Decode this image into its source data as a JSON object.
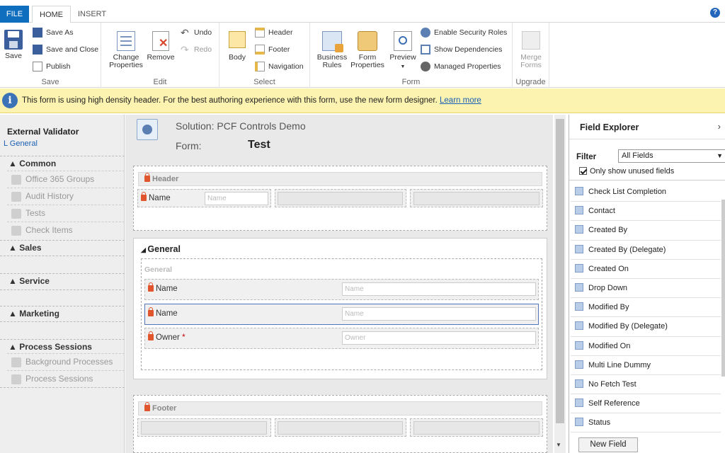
{
  "tabs": {
    "file": "FILE",
    "home": "HOME",
    "insert": "INSERT"
  },
  "help_label": "?",
  "ribbon": {
    "save": {
      "save": "Save",
      "save_as": "Save As",
      "save_close": "Save and Close",
      "publish": "Publish",
      "label": "Save"
    },
    "edit": {
      "change_properties_1": "Change",
      "change_properties_2": "Properties",
      "remove": "Remove",
      "undo": "Undo",
      "redo": "Redo",
      "label": "Edit"
    },
    "select": {
      "body": "Body",
      "header": "Header",
      "footer": "Footer",
      "navigation": "Navigation",
      "label": "Select"
    },
    "form": {
      "business_rules_1": "Business",
      "business_rules_2": "Rules",
      "form_properties_1": "Form",
      "form_properties_2": "Properties",
      "preview": "Preview",
      "enable_security": "Enable Security Roles",
      "show_dependencies": "Show Dependencies",
      "managed_properties": "Managed Properties",
      "label": "Form"
    },
    "upgrade": {
      "merge_1": "Merge",
      "merge_2": "Forms",
      "label": "Upgrade"
    }
  },
  "notice": {
    "message": "This form is using high density header. For the best authoring experience with this form, use the new form designer.",
    "link": "Learn more"
  },
  "leftnav": {
    "title": "External Validator",
    "sub": "L General",
    "sections": [
      {
        "label": "Common",
        "items": [
          "Office 365 Groups",
          "Audit History",
          "Tests",
          "Check Items"
        ]
      },
      {
        "label": "Sales",
        "items": []
      },
      {
        "label": "Service",
        "items": []
      },
      {
        "label": "Marketing",
        "items": []
      },
      {
        "label": "Process Sessions",
        "items": [
          "Background Processes",
          "Process Sessions"
        ]
      }
    ]
  },
  "canvas": {
    "solution": "Solution: PCF Controls Demo",
    "form_label": "Form:",
    "form_name": "Test",
    "header_label": "Header",
    "header_field": "Name",
    "header_placeholder": "Name",
    "general_tab": "General",
    "general_section": "General",
    "fields": [
      {
        "label": "Name",
        "placeholder": "Name",
        "required": false
      },
      {
        "label": "Name",
        "placeholder": "Name",
        "required": false
      },
      {
        "label": "Owner",
        "placeholder": "Owner",
        "required": true
      }
    ],
    "footer_label": "Footer",
    "required_mark": "*"
  },
  "field_explorer": {
    "title": "Field Explorer",
    "chevron": "›",
    "filter_label": "Filter",
    "filter_value": "All Fields",
    "dd_arrow": "▼",
    "only_unused": "Only show unused fields",
    "items": [
      "Check List Completion",
      "Contact",
      "Created By",
      "Created By (Delegate)",
      "Created On",
      "Drop Down",
      "Modified By",
      "Modified By (Delegate)",
      "Modified On",
      "Multi Line Dummy",
      "No Fetch Test",
      "Self Reference",
      "Status"
    ],
    "new_field": "New Field"
  },
  "scroll_arrow": "▼",
  "colors": {
    "accent": "#106ebe",
    "notice_bg": "#fdf3b0",
    "lock": "#e0552c"
  }
}
